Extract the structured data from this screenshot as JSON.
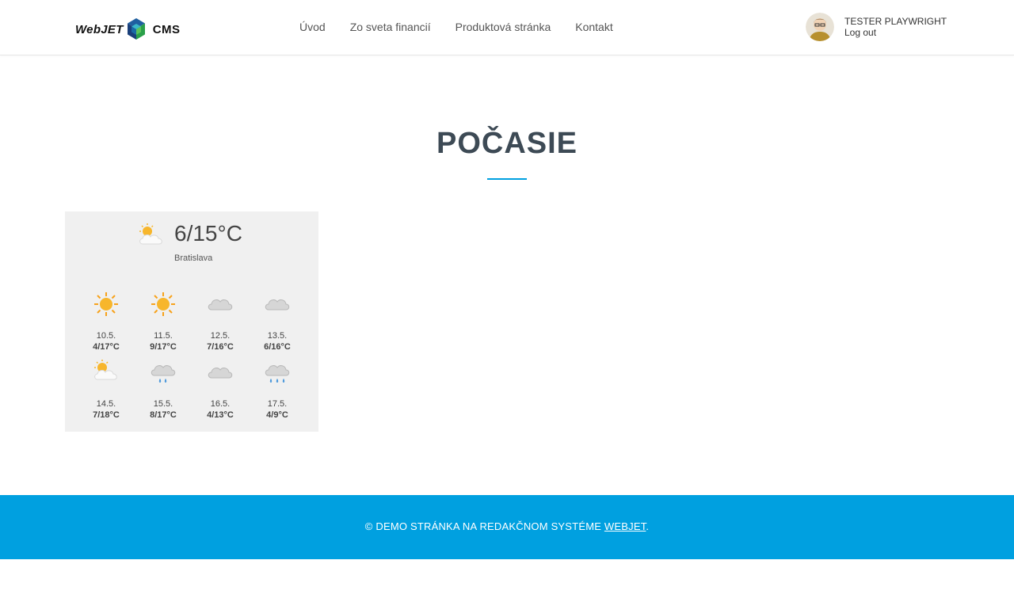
{
  "header": {
    "logo": {
      "word": "WebJET",
      "product": "CMS"
    },
    "nav": [
      {
        "label": "Úvod"
      },
      {
        "label": "Zo sveta financií"
      },
      {
        "label": "Produktová stránka"
      },
      {
        "label": "Kontakt"
      }
    ],
    "user": {
      "name": "TESTER PLAYWRIGHT",
      "logout_label": "Log out"
    }
  },
  "main": {
    "title": "POČASIE"
  },
  "weather": {
    "current": {
      "temp": "6/15°C",
      "icon": "partly-cloudy-icon",
      "city": "Bratislava"
    },
    "forecast": [
      {
        "date": "10.5.",
        "temp": "4/17°C",
        "icon": "sun-icon"
      },
      {
        "date": "11.5.",
        "temp": "9/17°C",
        "icon": "sun-icon"
      },
      {
        "date": "12.5.",
        "temp": "7/16°C",
        "icon": "cloud-icon"
      },
      {
        "date": "13.5.",
        "temp": "6/16°C",
        "icon": "cloud-icon"
      },
      {
        "date": "14.5.",
        "temp": "7/18°C",
        "icon": "partly-cloudy-icon"
      },
      {
        "date": "15.5.",
        "temp": "8/17°C",
        "icon": "light-rain-icon"
      },
      {
        "date": "16.5.",
        "temp": "4/13°C",
        "icon": "cloud-icon"
      },
      {
        "date": "17.5.",
        "temp": "4/9°C",
        "icon": "rain-icon"
      }
    ]
  },
  "footer": {
    "text": "© DEMO STRÁNKA NA REDAKČNOM SYSTÉME ",
    "link_label": "WEBJET",
    "suffix": "."
  },
  "colors": {
    "accent": "#00a0e0",
    "title": "#3d4a55",
    "widget_bg": "#f0f0f0"
  }
}
